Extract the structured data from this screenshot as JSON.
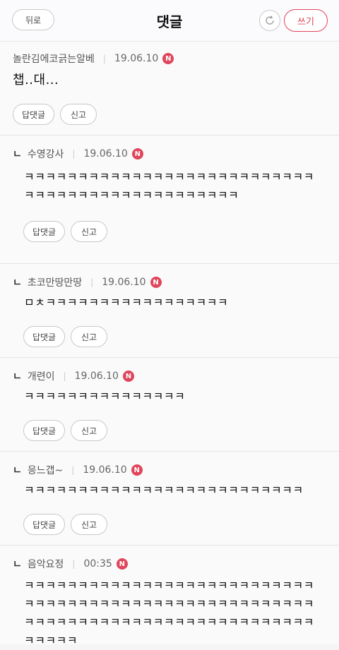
{
  "header": {
    "back_label": "뒤로",
    "title": "댓글",
    "refresh_icon": "refresh-icon",
    "write_label": "쓰기"
  },
  "actions": {
    "reply_label": "답댓글",
    "report_label": "신고"
  },
  "comments": [
    {
      "author": "놀란김에코긁는알베",
      "date": "19.06.10",
      "badge": "N",
      "text": "챕..대...",
      "is_reply": false
    },
    {
      "author": "수영강사",
      "date": "19.06.10",
      "badge": "N",
      "text": "ㅋㅋㅋㅋㅋㅋㅋㅋㅋㅋㅋㅋㅋㅋㅋㅋㅋㅋㅋㅋㅋㅋㅋㅋㅋㅋㅋㅋㅋㅋㅋㅋㅋㅋㅋㅋㅋㅋㅋㅋㅋㅋㅋㅋㅋㅋㅋ",
      "is_reply": true
    },
    {
      "author": "초코만땅만땅",
      "date": "19.06.10",
      "badge": "N",
      "text": "ㅁㅊㅋㅋㅋㅋㅋㅋㅋㅋㅋㅋㅋㅋㅋㅋㅋㅋㅋ",
      "is_reply": true
    },
    {
      "author": "개련이",
      "date": "19.06.10",
      "badge": "N",
      "text": "ㅋㅋㅋㅋㅋㅋㅋㅋㅋㅋㅋㅋㅋㅋㅋ",
      "is_reply": true
    },
    {
      "author": "응느갭~",
      "date": "19.06.10",
      "badge": "N",
      "text": "ㅋㅋㅋㅋㅋㅋㅋㅋㅋㅋㅋㅋㅋㅋㅋㅋㅋㅋㅋㅋㅋㅋㅋㅋㅋㅋ",
      "is_reply": true
    },
    {
      "author": "음악요정",
      "date": "00:35",
      "badge": "N",
      "text": "ㅋㅋㅋㅋㅋㅋㅋㅋㅋㅋㅋㅋㅋㅋㅋㅋㅋㅋㅋㅋㅋㅋㅋㅋㅋㅋㅋㅋㅋㅋㅋㅋㅋㅋㅋㅋㅋㅋㅋㅋㅋㅋㅋㅋㅋㅋㅋㅋㅋㅋㅋㅋㅋㅋㅋㅋㅋㅋㅋㅋㅋㅋㅋㅋㅋㅋㅋㅋㅋㅋㅋㅋㅋㅋㅋㅋㅋㅋㅋㅋㅋㅋㅋㅋㅋㅋ",
      "is_reply": true
    }
  ]
}
